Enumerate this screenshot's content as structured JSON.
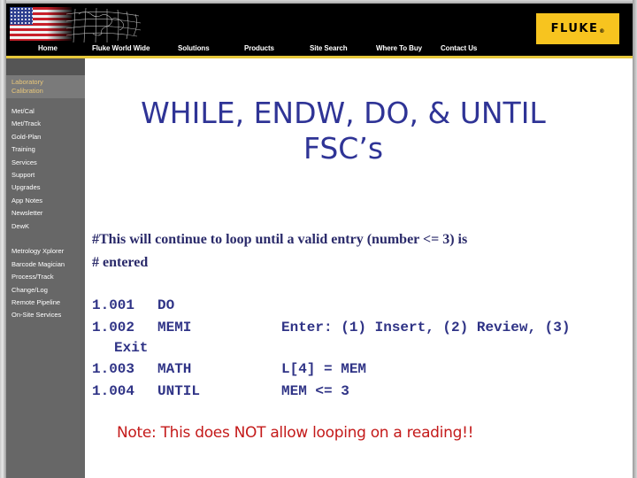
{
  "header": {
    "nav": [
      {
        "label": "Home"
      },
      {
        "label": "Fluke World Wide"
      },
      {
        "label": "Solutions"
      },
      {
        "label": "Products"
      },
      {
        "label": "Site Search"
      },
      {
        "label": "Where To Buy"
      },
      {
        "label": "Contact Us"
      }
    ],
    "logo": {
      "text": "FLUKE",
      "reg": "®"
    },
    "colors": {
      "logo_bg": "#f7c41f",
      "accent_line": "#e6c73a"
    }
  },
  "sidebar": {
    "section": "Laboratory Calibration",
    "section_lines": [
      "Laboratory",
      "Calibration"
    ],
    "items": [
      {
        "label": "Met/Cal"
      },
      {
        "label": "Met/Track"
      },
      {
        "label": "Gold-Plan"
      },
      {
        "label": "Training"
      },
      {
        "label": "Services"
      },
      {
        "label": "Support"
      },
      {
        "label": "Upgrades"
      },
      {
        "label": "App Notes"
      },
      {
        "label": "Newsletter"
      },
      {
        "label": "DewK"
      },
      {
        "label": "Metrology Xplorer"
      },
      {
        "label": "Barcode Magician"
      },
      {
        "label": "Process/Track"
      },
      {
        "label": "Change/Log"
      },
      {
        "label": "Remote Pipeline"
      },
      {
        "label": "On-Site Services"
      }
    ]
  },
  "main": {
    "title_line1": "WHILE, ENDW, DO, & UNTIL",
    "title_line2": "FSC’s",
    "comment_line1": "#This will continue to loop until a valid entry (number <= 3) is",
    "comment_line2": "# entered",
    "code_lines": [
      {
        "step": "1.001",
        "fsc": "DO",
        "data": ""
      },
      {
        "step": "1.002",
        "fsc": "MEMI",
        "data": "Enter: (1) Insert, (2) Review, (3)"
      },
      {
        "step": "",
        "fsc": "",
        "data": "Exit",
        "continuation": true
      },
      {
        "step": "1.003",
        "fsc": "MATH",
        "data": "L[4] = MEM"
      },
      {
        "step": "1.004",
        "fsc": "UNTIL",
        "data": "MEM <= 3"
      }
    ],
    "note": "Note:  This does NOT allow looping on a reading!!",
    "colors": {
      "title": "#2f3496",
      "note": "#c41a1a"
    }
  }
}
